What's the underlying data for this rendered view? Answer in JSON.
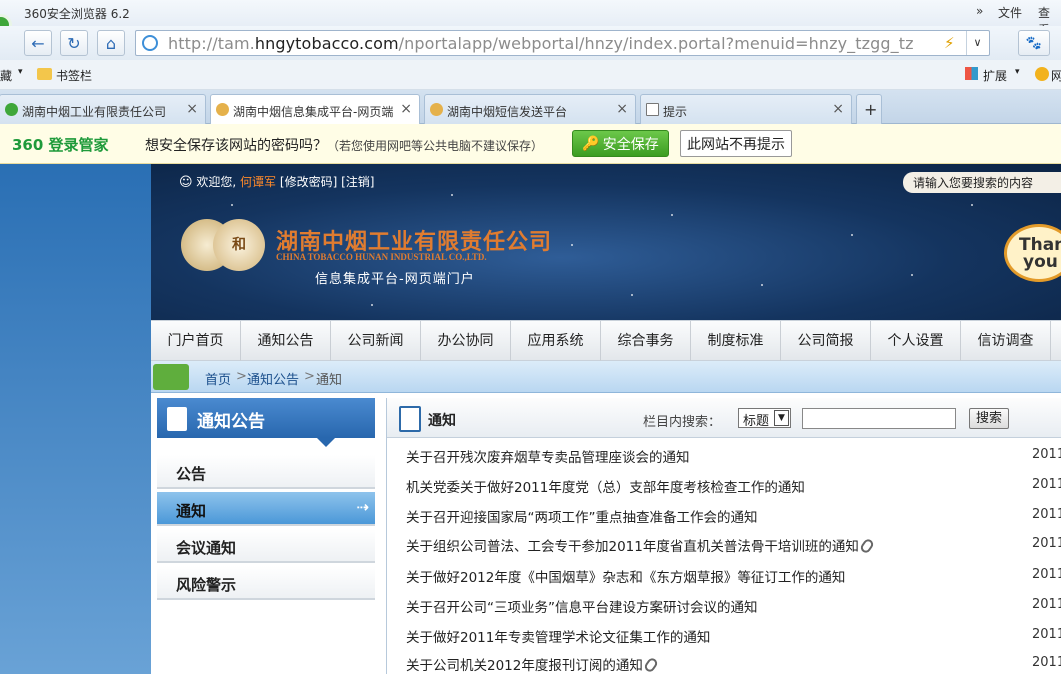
{
  "browser": {
    "title": "360安全浏览器 6.2",
    "menu_right": [
      "»",
      "文件",
      "查看"
    ],
    "url_prefix": "http://tam.",
    "url_domain": "hngytobacco.com",
    "url_path": "/nportalapp/webportal/hnzy/index.portal?menuid=hnzy_tzgg_tz",
    "bookmarks_left": "藏",
    "bookmarks_folder": "书签栏",
    "ext_label": "扩展",
    "ext_right": "网"
  },
  "tabs": [
    {
      "label": "湖南中烟工业有限责任公司",
      "close": "×"
    },
    {
      "label": "湖南中烟信息集成平台-网页端",
      "close": "×"
    },
    {
      "label": "湖南中烟短信发送平台",
      "close": "×"
    },
    {
      "label": "提示",
      "close": "×"
    },
    {
      "label": "+"
    }
  ],
  "pwbar": {
    "logo": "360 登录管家",
    "question": "想安全保存该网站的密码吗？",
    "hint": "（若您使用网吧等公共电脑不建议保存）",
    "save": "安全保存",
    "nomore": "此网站不再提示"
  },
  "banner": {
    "welcome": "欢迎您,",
    "user": "何谭军",
    "links": "[修改密码] [注销]",
    "search_hint": "请输入您要搜索的内容",
    "company_cn": "湖南中烟工业有限责任公司",
    "company_en": "CHINA  TOBACCO HUNAN INDUSTRIAL CO.,LTD.",
    "portal": "信息集成平台-网页端门户",
    "logo_char": "和",
    "bubble_l1": "Than",
    "bubble_l2": "you"
  },
  "menu": [
    "门户首页",
    "通知公告",
    "公司新闻",
    "办公协同",
    "应用系统",
    "综合事务",
    "制度标准",
    "公司简报",
    "个人设置",
    "信访调查"
  ],
  "breadcrumb": {
    "home": "首页",
    "section": "通知公告",
    "current": "通知",
    "sep": ">"
  },
  "sidebar": {
    "title": "通知公告",
    "items": [
      "公告",
      "通知",
      "会议通知",
      "风险警示"
    ]
  },
  "content": {
    "title": "通知",
    "search_label": "栏目内搜索：",
    "search_field": "标题",
    "search_button": "搜索",
    "notices": [
      {
        "title": "关于召开残次废弃烟草专卖品管理座谈会的通知",
        "date": "2011-",
        "clip": false
      },
      {
        "title": "机关党委关于做好2011年度党（总）支部年度考核检查工作的通知",
        "date": "2011-",
        "clip": false
      },
      {
        "title": "关于召开迎接国家局“两项工作”重点抽查准备工作会的通知",
        "date": "2011-",
        "clip": false
      },
      {
        "title": "关于组织公司普法、工会专干参加2011年度省直机关普法骨干培训班的通知",
        "date": "2011-",
        "clip": true
      },
      {
        "title": "关于做好2012年度《中国烟草》杂志和《东方烟草报》等征订工作的通知",
        "date": "2011-",
        "clip": false
      },
      {
        "title": "关于召开公司“三项业务”信息平台建设方案研讨会议的通知",
        "date": "2011-",
        "clip": false
      },
      {
        "title": "关于做好2011年专卖管理学术论文征集工作的通知",
        "date": "2011-",
        "clip": false
      },
      {
        "title": "关于公司机关2012年度报刊订阅的通知",
        "date": "2011-",
        "clip": true
      }
    ]
  },
  "colors": {
    "accent": "#2867ae",
    "brand_orange": "#e07c30",
    "green": "#3c9d22"
  }
}
